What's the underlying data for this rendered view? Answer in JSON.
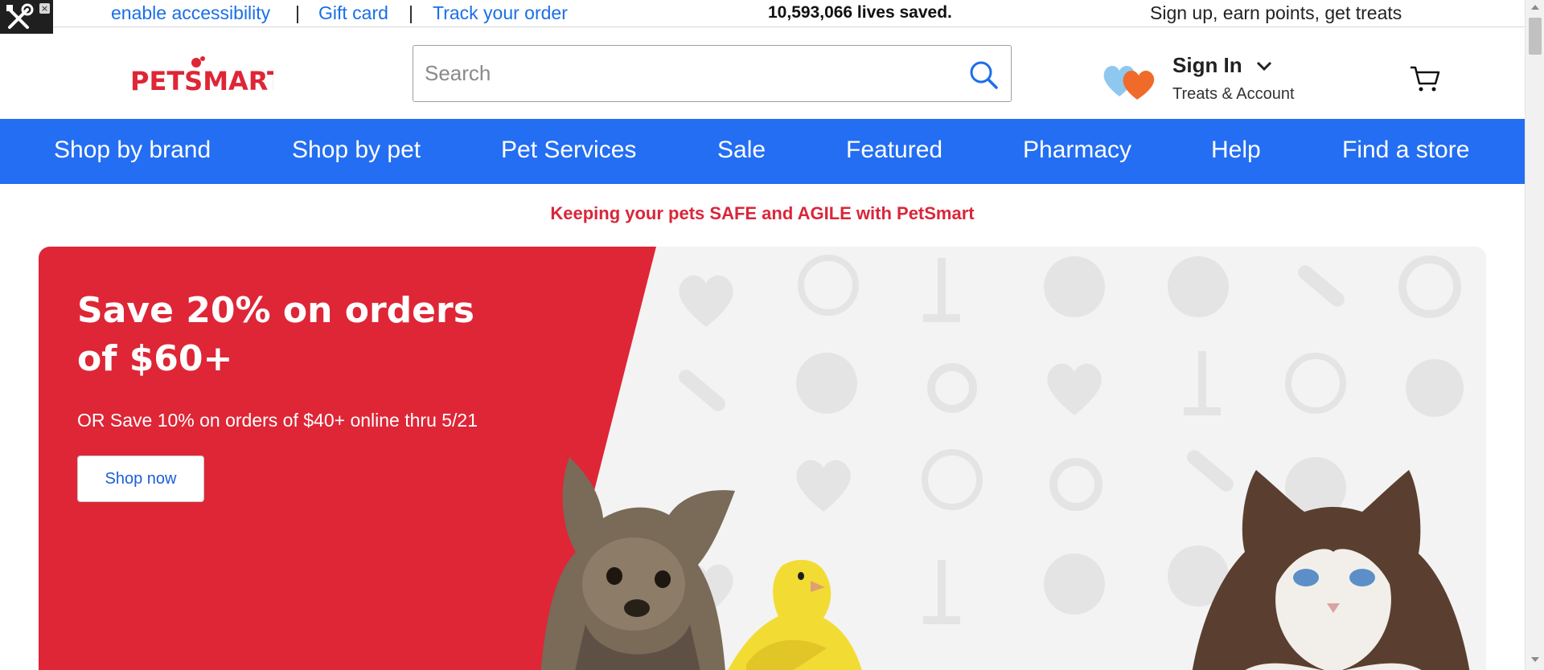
{
  "utility": {
    "accessibility_link": "enable accessibility",
    "separator": "|",
    "gift_card_link": "Gift card",
    "track_order_link": "Track your order",
    "lives_saved": "10,593,066 lives saved.",
    "promo": "Sign up, earn points, get treats"
  },
  "header": {
    "logo_text": "PETSMART",
    "search_placeholder": "Search",
    "sign_in_label": "Sign In",
    "account_sublabel": "Treats & Account"
  },
  "nav": {
    "items": [
      "Shop by brand",
      "Shop by pet",
      "Pet Services",
      "Sale",
      "Featured",
      "Pharmacy",
      "Help",
      "Find a store"
    ]
  },
  "safety_banner": "Keeping your pets SAFE and AGILE with PetSmart",
  "hero": {
    "headline": "Save 20% on orders of $60+",
    "subtext": "OR Save 10% on orders of $40+ online thru 5/21",
    "cta_label": "Shop now"
  },
  "colors": {
    "brand_blue": "#236ef2",
    "brand_red": "#de2636",
    "link_blue": "#1a6fe8"
  }
}
